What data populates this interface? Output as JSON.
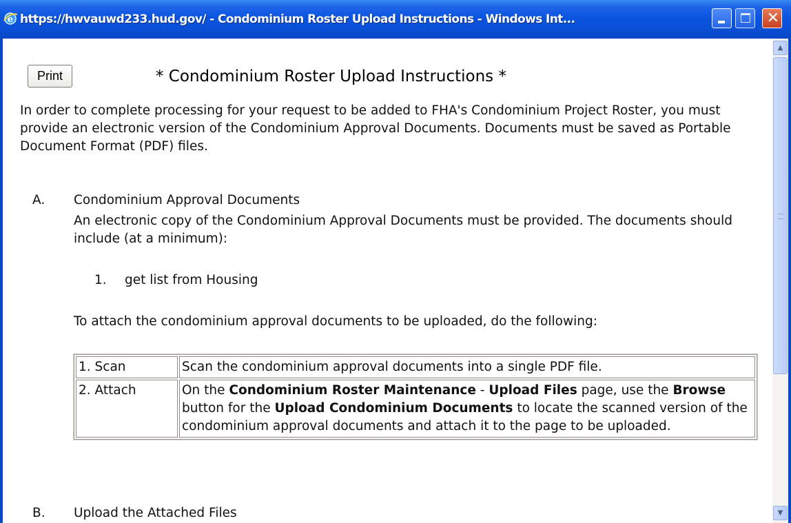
{
  "window": {
    "title": "https://hwvauwd233.hud.gov/ - Condominium Roster Upload Instructions - Windows Int...",
    "title_icon": "internet-explorer-icon",
    "controls": {
      "minimize_icon": "minimize-icon",
      "maximize_icon": "maximize-icon",
      "close_icon": "close-icon",
      "close_glyph": "✕"
    }
  },
  "page": {
    "print_label": "Print",
    "heading": "* Condominium Roster Upload Instructions *",
    "intro": "In order to complete processing for your request to be added to FHA's Condominium Project Roster, you must provide an electronic version of the Condominium Approval Documents. Documents must be saved as Portable Document Format (PDF) files."
  },
  "section_a": {
    "letter": "A.",
    "title": "Condominium Approval Documents",
    "description": "An electronic copy of the Condominium Approval Documents must be provided. The documents should include (at a minimum):",
    "list": [
      {
        "number": "1.",
        "text": "get list from Housing"
      }
    ],
    "attach_intro": "To attach the condominium approval documents to be uploaded, do the following:",
    "steps": [
      {
        "step": "1. Scan",
        "detail": [
          {
            "text": "Scan the condominium approval documents into a single PDF file.",
            "bold": false
          }
        ]
      },
      {
        "step": "2. Attach",
        "detail": [
          {
            "text": "On the ",
            "bold": false
          },
          {
            "text": "Condominium Roster Maintenance",
            "bold": true
          },
          {
            "text": " - ",
            "bold": false
          },
          {
            "text": "Upload Files",
            "bold": true
          },
          {
            "text": " page, use the ",
            "bold": false
          },
          {
            "text": "Browse",
            "bold": true
          },
          {
            "text": " button for the ",
            "bold": false
          },
          {
            "text": "Upload Condominium Documents",
            "bold": true
          },
          {
            "text": " to locate the scanned version of the condominium approval documents and attach it to the page to be uploaded.",
            "bold": false
          }
        ]
      }
    ]
  },
  "section_b": {
    "letter": "B.",
    "title": "Upload the Attached Files"
  },
  "scrollbar": {
    "up_glyph": "▲",
    "down_glyph": "▼"
  },
  "colors": {
    "titlebar": "#0a4fd6",
    "close_button": "#c8401c",
    "scrollbar_thumb": "#b9cdf7"
  }
}
